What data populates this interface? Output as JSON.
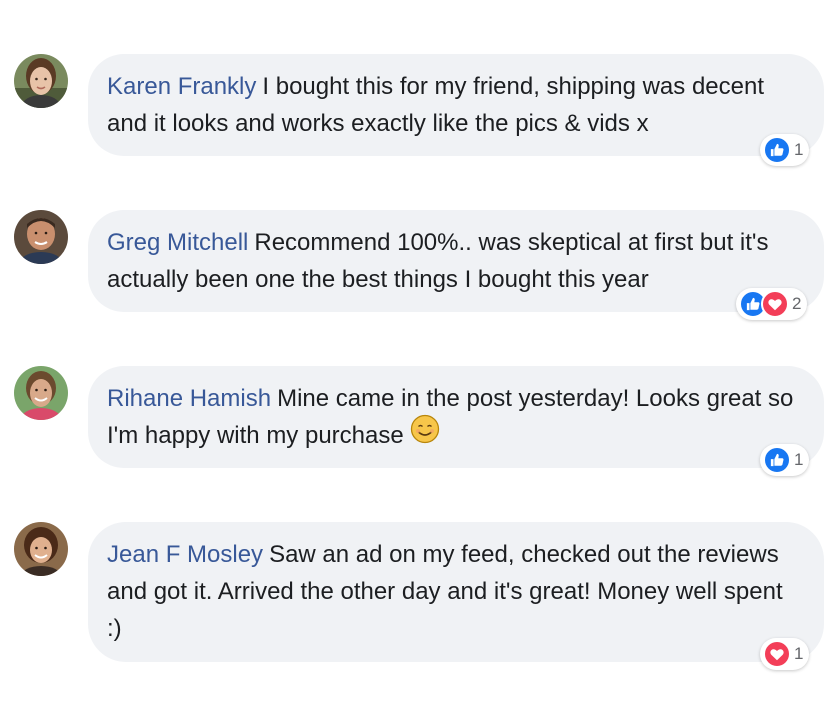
{
  "colors": {
    "bubble_bg": "#f0f2f5",
    "author": "#385898",
    "text": "#1c1e21",
    "like_blue": "#1877f2",
    "love_red": "#f33e58",
    "count_gray": "#65676b"
  },
  "comments": [
    {
      "author": "Karen Frankly",
      "text": "I bought this for my friend, shipping was decent and it looks and works exactly like the pics & vids x",
      "reactions": [
        "like-icon"
      ],
      "reaction_count": "1"
    },
    {
      "author": "Greg Mitchell",
      "text": "Recommend 100%.. was skeptical at first but it's actually been one the best things I bought this year",
      "reactions": [
        "like-icon",
        "love-icon"
      ],
      "reaction_count": "2"
    },
    {
      "author": "Rihane Hamish",
      "text": "Mine came in the post yesterday! Looks great so I'm happy with my purchase",
      "emoji": "smiling-face-icon",
      "reactions": [
        "like-icon"
      ],
      "reaction_count": "1"
    },
    {
      "author": "Jean F Mosley",
      "text": "Saw an ad on my feed, checked out the reviews and got it. Arrived the other day and it's great! Money well spent :)",
      "reactions": [
        "love-icon"
      ],
      "reaction_count": "1"
    }
  ]
}
